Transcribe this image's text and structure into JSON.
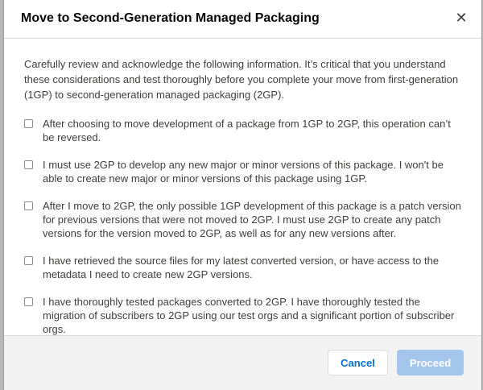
{
  "modal": {
    "title": "Move to Second-Generation Managed Packaging",
    "close_icon": "close-icon",
    "close_glyph": "✕"
  },
  "body": {
    "intro": "Carefully review and acknowledge the following information. It’s critical that you understand these considerations and test thoroughly before you complete your move from first-generation (1GP) to second-generation managed packaging (2GP).",
    "items": [
      {
        "label": "After choosing to move development of a package from 1GP to 2GP, this operation can’t be reversed.",
        "checked": false
      },
      {
        "label": "I must use 2GP to develop any new major or minor versions of this package. I won't be able to create new major or minor versions of this package using 1GP.",
        "checked": false
      },
      {
        "label": "After I move to 2GP, the only possible 1GP development of this package is a patch version for previous versions that were not moved to 2GP. I must use 2GP to create any patch versions for the version moved to 2GP, as well as for any new versions after.",
        "checked": false
      },
      {
        "label": "I have retrieved the source files for my latest converted version, or have access to the metadata I need to create new 2GP versions.",
        "checked": false
      },
      {
        "label": "I have thoroughly tested packages converted to 2GP. I have thoroughly tested the migration of subscribers to 2GP using our test orgs and a significant portion of subscriber orgs.",
        "checked": false
      }
    ]
  },
  "footer": {
    "cancel_label": "Cancel",
    "proceed_label": "Proceed",
    "proceed_disabled": true
  },
  "colors": {
    "link_blue": "#0070d2",
    "disabled_brand": "#a4c5ec",
    "footer_bg": "#f3f2f2",
    "text": "#3e3e3c"
  }
}
